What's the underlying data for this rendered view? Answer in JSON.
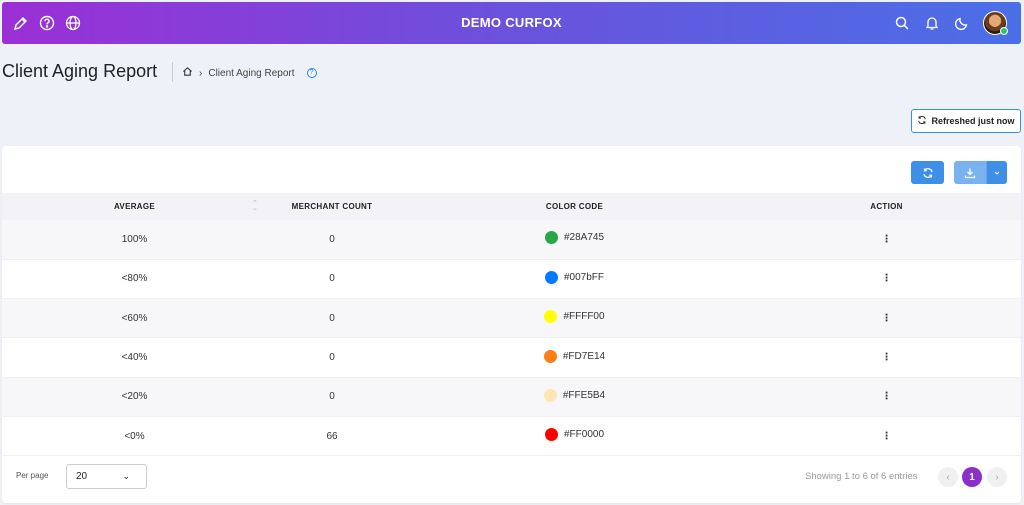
{
  "app": {
    "brand": "DEMO CURFOX"
  },
  "topbar": {
    "left_icons": [
      "brush-icon",
      "help-icon",
      "globe-icon"
    ],
    "right_icons": [
      "search-icon",
      "bell-icon",
      "moon-icon"
    ]
  },
  "page": {
    "title": "Client Aging Report",
    "breadcrumb_current": "Client Aging Report",
    "refresh_label": "Refreshed just now"
  },
  "table": {
    "headers": [
      "AVERAGE",
      "MERCHANT COUNT",
      "COLOR CODE",
      "ACTION"
    ],
    "rows": [
      {
        "average": "100%",
        "count": "0",
        "color": "#28A745",
        "code": "#28A745"
      },
      {
        "average": "<80%",
        "count": "0",
        "color": "#007bFF",
        "code": "#007bFF"
      },
      {
        "average": "<60%",
        "count": "0",
        "color": "#FFFF00",
        "code": "#FFFF00"
      },
      {
        "average": "<40%",
        "count": "0",
        "color": "#FD7E14",
        "code": "#FD7E14"
      },
      {
        "average": "<20%",
        "count": "0",
        "color": "#FFE5B4",
        "code": "#FFE5B4"
      },
      {
        "average": "<0%",
        "count": "66",
        "color": "#FF0000",
        "code": "#FF0000"
      }
    ],
    "action_glyph": "⋮"
  },
  "footer": {
    "per_page_label": "Per page",
    "per_page_value": "20",
    "showing": "Showing 1 to 6 of 6 entries",
    "current_page": "1",
    "prev_glyph": "‹",
    "next_glyph": "›"
  },
  "colors": {
    "accent": "#8b2fc9",
    "primary": "#3d8fe7"
  }
}
